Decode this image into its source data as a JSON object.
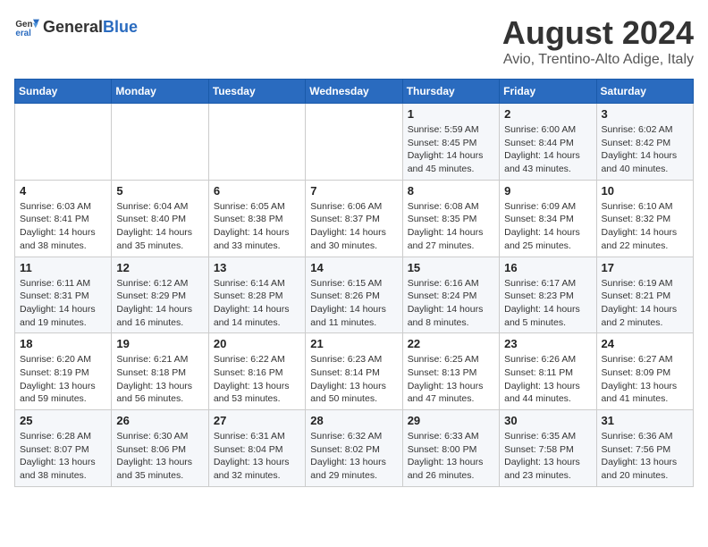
{
  "logo": {
    "text_general": "General",
    "text_blue": "Blue"
  },
  "title": "August 2024",
  "subtitle": "Avio, Trentino-Alto Adige, Italy",
  "days_of_week": [
    "Sunday",
    "Monday",
    "Tuesday",
    "Wednesday",
    "Thursday",
    "Friday",
    "Saturday"
  ],
  "weeks": [
    [
      {
        "day": "",
        "info": ""
      },
      {
        "day": "",
        "info": ""
      },
      {
        "day": "",
        "info": ""
      },
      {
        "day": "",
        "info": ""
      },
      {
        "day": "1",
        "info": "Sunrise: 5:59 AM\nSunset: 8:45 PM\nDaylight: 14 hours and 45 minutes."
      },
      {
        "day": "2",
        "info": "Sunrise: 6:00 AM\nSunset: 8:44 PM\nDaylight: 14 hours and 43 minutes."
      },
      {
        "day": "3",
        "info": "Sunrise: 6:02 AM\nSunset: 8:42 PM\nDaylight: 14 hours and 40 minutes."
      }
    ],
    [
      {
        "day": "4",
        "info": "Sunrise: 6:03 AM\nSunset: 8:41 PM\nDaylight: 14 hours and 38 minutes."
      },
      {
        "day": "5",
        "info": "Sunrise: 6:04 AM\nSunset: 8:40 PM\nDaylight: 14 hours and 35 minutes."
      },
      {
        "day": "6",
        "info": "Sunrise: 6:05 AM\nSunset: 8:38 PM\nDaylight: 14 hours and 33 minutes."
      },
      {
        "day": "7",
        "info": "Sunrise: 6:06 AM\nSunset: 8:37 PM\nDaylight: 14 hours and 30 minutes."
      },
      {
        "day": "8",
        "info": "Sunrise: 6:08 AM\nSunset: 8:35 PM\nDaylight: 14 hours and 27 minutes."
      },
      {
        "day": "9",
        "info": "Sunrise: 6:09 AM\nSunset: 8:34 PM\nDaylight: 14 hours and 25 minutes."
      },
      {
        "day": "10",
        "info": "Sunrise: 6:10 AM\nSunset: 8:32 PM\nDaylight: 14 hours and 22 minutes."
      }
    ],
    [
      {
        "day": "11",
        "info": "Sunrise: 6:11 AM\nSunset: 8:31 PM\nDaylight: 14 hours and 19 minutes."
      },
      {
        "day": "12",
        "info": "Sunrise: 6:12 AM\nSunset: 8:29 PM\nDaylight: 14 hours and 16 minutes."
      },
      {
        "day": "13",
        "info": "Sunrise: 6:14 AM\nSunset: 8:28 PM\nDaylight: 14 hours and 14 minutes."
      },
      {
        "day": "14",
        "info": "Sunrise: 6:15 AM\nSunset: 8:26 PM\nDaylight: 14 hours and 11 minutes."
      },
      {
        "day": "15",
        "info": "Sunrise: 6:16 AM\nSunset: 8:24 PM\nDaylight: 14 hours and 8 minutes."
      },
      {
        "day": "16",
        "info": "Sunrise: 6:17 AM\nSunset: 8:23 PM\nDaylight: 14 hours and 5 minutes."
      },
      {
        "day": "17",
        "info": "Sunrise: 6:19 AM\nSunset: 8:21 PM\nDaylight: 14 hours and 2 minutes."
      }
    ],
    [
      {
        "day": "18",
        "info": "Sunrise: 6:20 AM\nSunset: 8:19 PM\nDaylight: 13 hours and 59 minutes."
      },
      {
        "day": "19",
        "info": "Sunrise: 6:21 AM\nSunset: 8:18 PM\nDaylight: 13 hours and 56 minutes."
      },
      {
        "day": "20",
        "info": "Sunrise: 6:22 AM\nSunset: 8:16 PM\nDaylight: 13 hours and 53 minutes."
      },
      {
        "day": "21",
        "info": "Sunrise: 6:23 AM\nSunset: 8:14 PM\nDaylight: 13 hours and 50 minutes."
      },
      {
        "day": "22",
        "info": "Sunrise: 6:25 AM\nSunset: 8:13 PM\nDaylight: 13 hours and 47 minutes."
      },
      {
        "day": "23",
        "info": "Sunrise: 6:26 AM\nSunset: 8:11 PM\nDaylight: 13 hours and 44 minutes."
      },
      {
        "day": "24",
        "info": "Sunrise: 6:27 AM\nSunset: 8:09 PM\nDaylight: 13 hours and 41 minutes."
      }
    ],
    [
      {
        "day": "25",
        "info": "Sunrise: 6:28 AM\nSunset: 8:07 PM\nDaylight: 13 hours and 38 minutes."
      },
      {
        "day": "26",
        "info": "Sunrise: 6:30 AM\nSunset: 8:06 PM\nDaylight: 13 hours and 35 minutes."
      },
      {
        "day": "27",
        "info": "Sunrise: 6:31 AM\nSunset: 8:04 PM\nDaylight: 13 hours and 32 minutes."
      },
      {
        "day": "28",
        "info": "Sunrise: 6:32 AM\nSunset: 8:02 PM\nDaylight: 13 hours and 29 minutes."
      },
      {
        "day": "29",
        "info": "Sunrise: 6:33 AM\nSunset: 8:00 PM\nDaylight: 13 hours and 26 minutes."
      },
      {
        "day": "30",
        "info": "Sunrise: 6:35 AM\nSunset: 7:58 PM\nDaylight: 13 hours and 23 minutes."
      },
      {
        "day": "31",
        "info": "Sunrise: 6:36 AM\nSunset: 7:56 PM\nDaylight: 13 hours and 20 minutes."
      }
    ]
  ]
}
